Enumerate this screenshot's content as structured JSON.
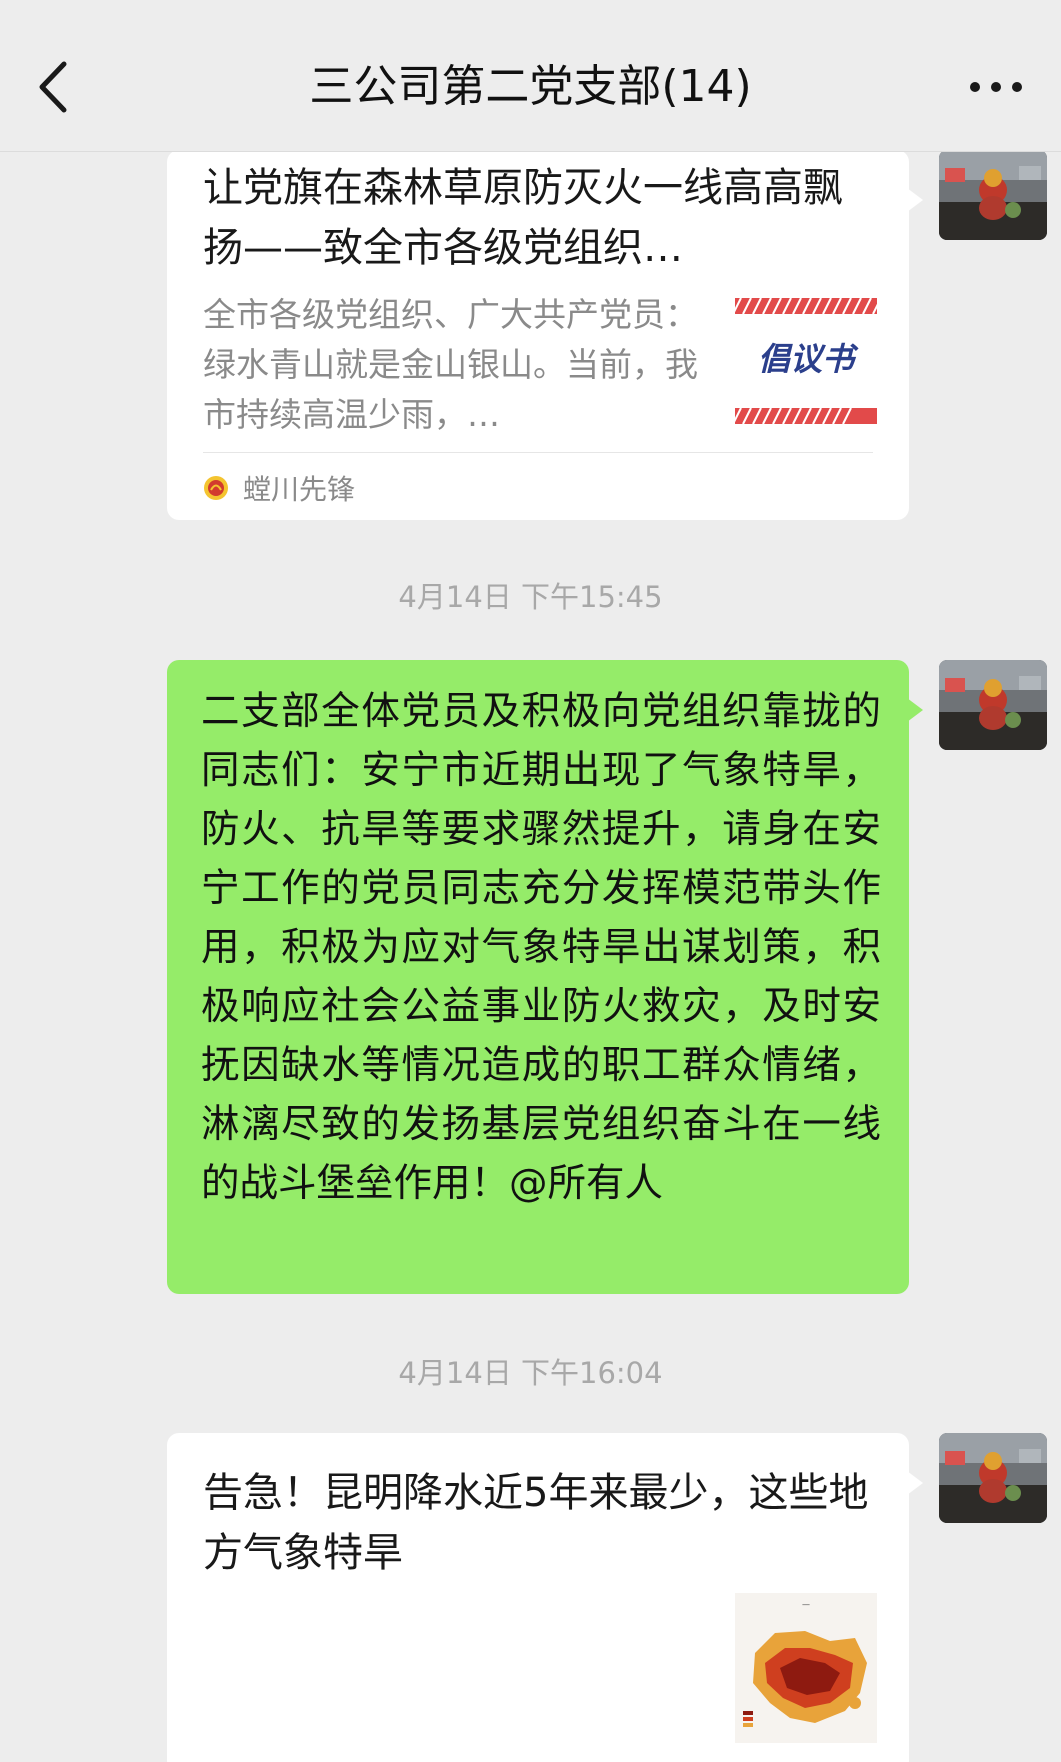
{
  "header": {
    "title": "三公司第二党支部(14)",
    "back_icon": "chevron-left-icon",
    "more_icon": "more-dots-icon"
  },
  "messages": [
    {
      "type": "article_card",
      "title": "让党旗在森林草原防灭火一线高高飘扬——致全市各级党组织…",
      "description": "全市各级党组织、广大共产党员：绿水青山就是金山银山。当前，我市持续高温少雨，…",
      "thumbnail_text": "倡议书",
      "source": "螳川先锋"
    },
    {
      "type": "timestamp",
      "text": "4月14日 下午15:45"
    },
    {
      "type": "text",
      "text": "二支部全体党员及积极向党组织靠拢的同志们：安宁市近期出现了气象特旱，防火、抗旱等要求骤然提升，请身在安宁工作的党员同志充分发挥模范带头作用，积极为应对气象特旱出谋划策，积极响应社会公益事业防火救灾，及时安抚因缺水等情况造成的职工群众情绪，淋漓尽致的发扬基层党组织奋斗在一线的战斗堡垒作用！@所有人"
    },
    {
      "type": "timestamp",
      "text": "4月14日 下午16:04"
    },
    {
      "type": "article_card",
      "title": "告急！昆明降水近5年来最少，这些地方气象特旱",
      "thumbnail_icon": "drought-map-icon"
    }
  ],
  "colors": {
    "background": "#ededed",
    "self_bubble": "#95ec69",
    "card": "#ffffff",
    "meta_text": "#a8a8a8"
  }
}
